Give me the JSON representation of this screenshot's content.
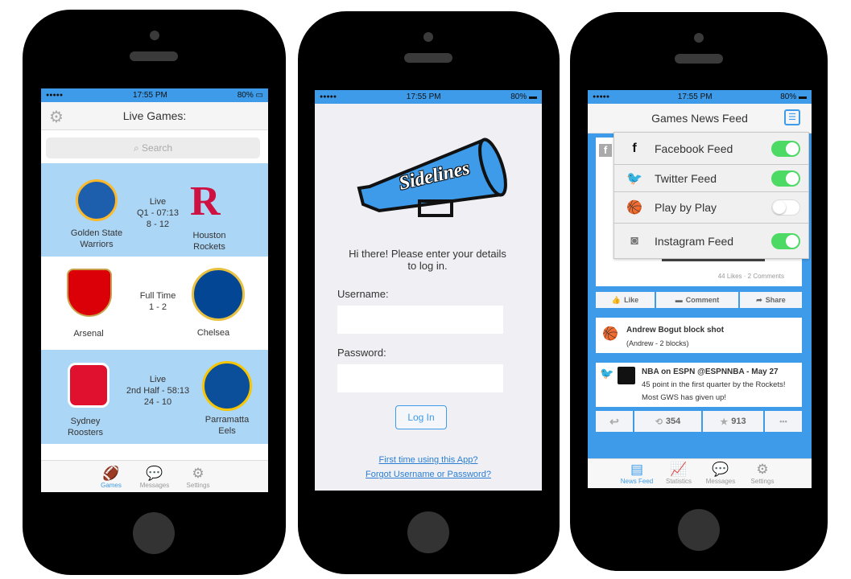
{
  "status": {
    "time": "17:55 PM",
    "battery": "80%",
    "signal": "●●●●●"
  },
  "phone1": {
    "title": "Live Games:",
    "search_placeholder": "Search",
    "games": [
      {
        "home": "Golden State Warriors",
        "home_l1": "Golden State",
        "home_l2": "Warriors",
        "away_l1": "Houston",
        "away_l2": "Rockets",
        "status": "Live",
        "period": "Q1 - 07:13",
        "score": "8 - 12",
        "home_color": "#1d5fad",
        "away_color": "#ce1141"
      },
      {
        "home_l1": "Arsenal",
        "home_l2": "",
        "away_l1": "Chelsea",
        "away_l2": "",
        "status": "Full Time",
        "period": "1 - 2",
        "score": "",
        "home_color": "#db0007",
        "away_color": "#034694"
      },
      {
        "home_l1": "Sydney",
        "home_l2": "Roosters",
        "away_l1": "Parramatta",
        "away_l2": "Eels",
        "status": "Live",
        "period": "2nd Half - 58:13",
        "score": "24 - 10",
        "home_color": "#e0102f",
        "away_color": "#0b4e9a"
      }
    ],
    "tabs": [
      {
        "label": "Games",
        "icon": "football-icon"
      },
      {
        "label": "Messages",
        "icon": "chat-icon"
      },
      {
        "label": "Settings",
        "icon": "gear-icon"
      }
    ]
  },
  "phone2": {
    "logo": "Sidelines",
    "greeting": "Hi there! Please enter your details to log in.",
    "username_label": "Username:",
    "password_label": "Password:",
    "username_value": "",
    "password_value": "",
    "login": "Log In",
    "first_time": "First time using this App?",
    "forgot": "Forgot Username or Password?"
  },
  "phone3": {
    "title": "Games News Feed",
    "feeds": [
      {
        "label": "Facebook Feed",
        "icon": "facebook-icon",
        "on": true
      },
      {
        "label": "Twitter Feed",
        "icon": "twitter-icon",
        "on": true
      },
      {
        "label": "Play by Play",
        "icon": "basketball-icon",
        "on": false
      },
      {
        "label": "Instagram Feed",
        "icon": "instagram-icon",
        "on": true
      }
    ],
    "post_stats": "44 Likes · 2 Comments",
    "like": "Like",
    "comment": "Comment",
    "share": "Share",
    "pbp_title": "Andrew Bogut block shot",
    "pbp_detail": "(Andrew - 2 blocks)",
    "tweet_head": "NBA on ESPN @ESPNNBA - May 27",
    "tweet_body": "45 point in the first quarter by the Rockets! Most GWS has given up!",
    "retweets": "354",
    "favorites": "913",
    "tabs": [
      {
        "label": "News Feed",
        "icon": "newspaper-icon"
      },
      {
        "label": "Statistics",
        "icon": "chart-icon"
      },
      {
        "label": "Messages",
        "icon": "chat-icon"
      },
      {
        "label": "Settings",
        "icon": "gear-icon"
      }
    ]
  },
  "colors": {
    "accent": "#3d9be9",
    "row_highlight": "#acd6f5",
    "toggle_on": "#4cd964"
  }
}
